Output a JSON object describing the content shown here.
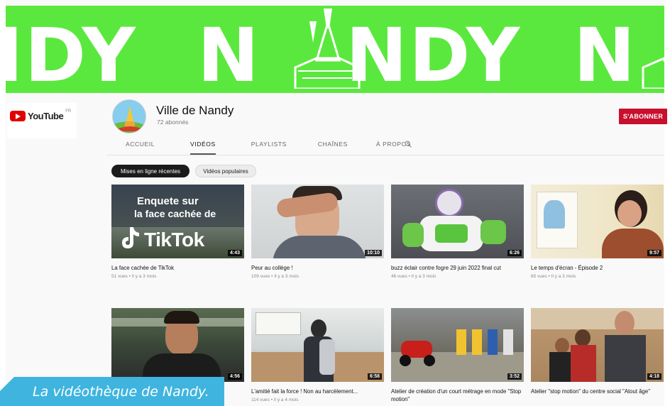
{
  "banner": {
    "text_1": "IDY",
    "text_2": "N",
    "text_2b": "NDY",
    "text_3": "N"
  },
  "youtube": {
    "logo_text": "YouTube",
    "logo_sup": "FR"
  },
  "channel": {
    "name": "Ville de Nandy",
    "subscribers": "72 abonnés",
    "subscribe_label": "S'ABONNER"
  },
  "tabs": [
    {
      "label": "ACCUEIL"
    },
    {
      "label": "VIDÉOS"
    },
    {
      "label": "PLAYLISTS"
    },
    {
      "label": "CHAÎNES"
    },
    {
      "label": "À PROPOS"
    }
  ],
  "chips": {
    "recent": "Mises en ligne récentes",
    "popular": "Vidéos populaires"
  },
  "videos": [
    {
      "title": "La face cachée de TikTok",
      "meta": "51 vues • Il y a 3 mois",
      "duration": "4:43",
      "thumb_text_1": "Enquete sur",
      "thumb_text_2": "la face cachée de",
      "thumb_text_3": "TikTok"
    },
    {
      "title": "Peur au collège !",
      "meta": "109 vues • Il y a 3 mois",
      "duration": "10:10"
    },
    {
      "title": "buzz éclair contre fogre 29 juin 2022 final cut",
      "meta": "46 vues • Il y a 3 mois",
      "duration": "6:26"
    },
    {
      "title": "Le temps d'écran - Épisode 2",
      "meta": "65 vues • Il y a 3 mois",
      "duration": "9:57"
    },
    {
      "title": "",
      "meta": "",
      "duration": "4:56"
    },
    {
      "title": "L'amitié fait la force ! Non au harcèlement...",
      "meta": "114 vues • Il y a 4 mois",
      "duration": "6:58"
    },
    {
      "title": "Atelier de création d'un court métrage en mode \"Stop motion\"",
      "meta": "",
      "duration": "3:52"
    },
    {
      "title": "Atelier \"stop motion\" du centre social \"Atout âge\"",
      "meta": "",
      "duration": "4:18"
    }
  ],
  "caption": "La vidéothèque de Nandy.",
  "colors": {
    "banner_green": "#5be83e",
    "subscribe_red": "#c8102e",
    "caption_blue": "#3fb4de"
  }
}
